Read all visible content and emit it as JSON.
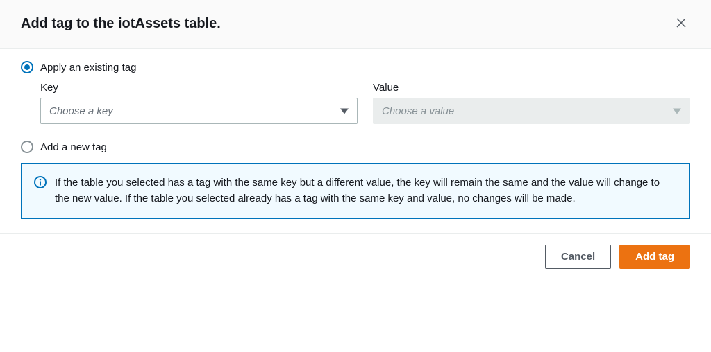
{
  "modal": {
    "title": "Add tag to the iotAssets table."
  },
  "options": {
    "apply_existing": {
      "label": "Apply an existing tag",
      "selected": true
    },
    "add_new": {
      "label": "Add a new tag",
      "selected": false
    }
  },
  "fields": {
    "key": {
      "label": "Key",
      "placeholder": "Choose a key"
    },
    "value": {
      "label": "Value",
      "placeholder": "Choose a value"
    }
  },
  "info": {
    "message": "If the table you selected has a tag with the same key but a different value, the key will remain the same and the value will change to the new value. If the table you selected already has a tag with the same key and value, no changes will be made."
  },
  "footer": {
    "cancel": "Cancel",
    "submit": "Add tag"
  }
}
